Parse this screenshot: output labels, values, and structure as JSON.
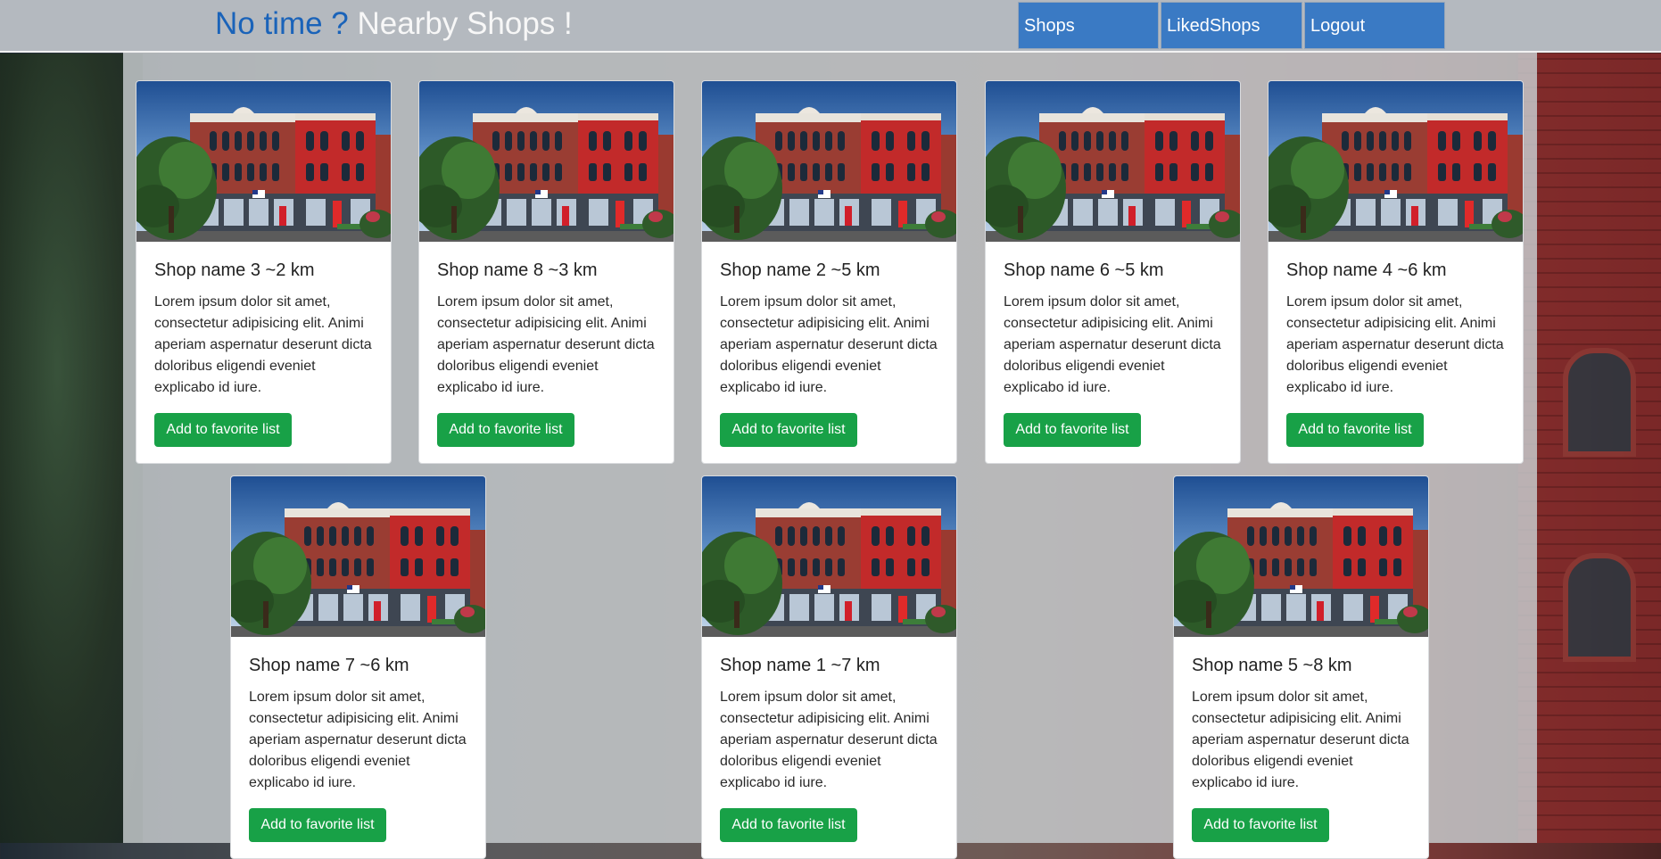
{
  "header": {
    "brand_prefix": "No time ?",
    "brand_suffix": "Nearby Shops !",
    "nav": [
      {
        "label": "Shops"
      },
      {
        "label": "LikedShops"
      },
      {
        "label": "Logout"
      }
    ]
  },
  "colors": {
    "accent_blue": "#1a63b9",
    "nav_blue": "#3a7ac4",
    "button_green": "#18a147"
  },
  "shops": [
    {
      "title": "Shop name 3 ~2 km",
      "description": "Lorem ipsum dolor sit amet, consectetur adipisicing elit. Animi aperiam aspernatur deserunt dicta doloribus eligendi eveniet explicabo id iure.",
      "button": "Add to favorite list"
    },
    {
      "title": "Shop name 8 ~3 km",
      "description": "Lorem ipsum dolor sit amet, consectetur adipisicing elit. Animi aperiam aspernatur deserunt dicta doloribus eligendi eveniet explicabo id iure.",
      "button": "Add to favorite list"
    },
    {
      "title": "Shop name 2 ~5 km",
      "description": "Lorem ipsum dolor sit amet, consectetur adipisicing elit. Animi aperiam aspernatur deserunt dicta doloribus eligendi eveniet explicabo id iure.",
      "button": "Add to favorite list"
    },
    {
      "title": "Shop name 6 ~5 km",
      "description": "Lorem ipsum dolor sit amet, consectetur adipisicing elit. Animi aperiam aspernatur deserunt dicta doloribus eligendi eveniet explicabo id iure.",
      "button": "Add to favorite list"
    },
    {
      "title": "Shop name 4 ~6 km",
      "description": "Lorem ipsum dolor sit amet, consectetur adipisicing elit. Animi aperiam aspernatur deserunt dicta doloribus eligendi eveniet explicabo id iure.",
      "button": "Add to favorite list"
    },
    {
      "title": "Shop name 7 ~6 km",
      "description": "Lorem ipsum dolor sit amet, consectetur adipisicing elit. Animi aperiam aspernatur deserunt dicta doloribus eligendi eveniet explicabo id iure.",
      "button": "Add to favorite list"
    },
    {
      "title": "Shop name 1 ~7 km",
      "description": "Lorem ipsum dolor sit amet, consectetur adipisicing elit. Animi aperiam aspernatur deserunt dicta doloribus eligendi eveniet explicabo id iure.",
      "button": "Add to favorite list"
    },
    {
      "title": "Shop name 5 ~8 km",
      "description": "Lorem ipsum dolor sit amet, consectetur adipisicing elit. Animi aperiam aspernatur deserunt dicta doloribus eligendi eveniet explicabo id iure.",
      "button": "Add to favorite list"
    }
  ]
}
